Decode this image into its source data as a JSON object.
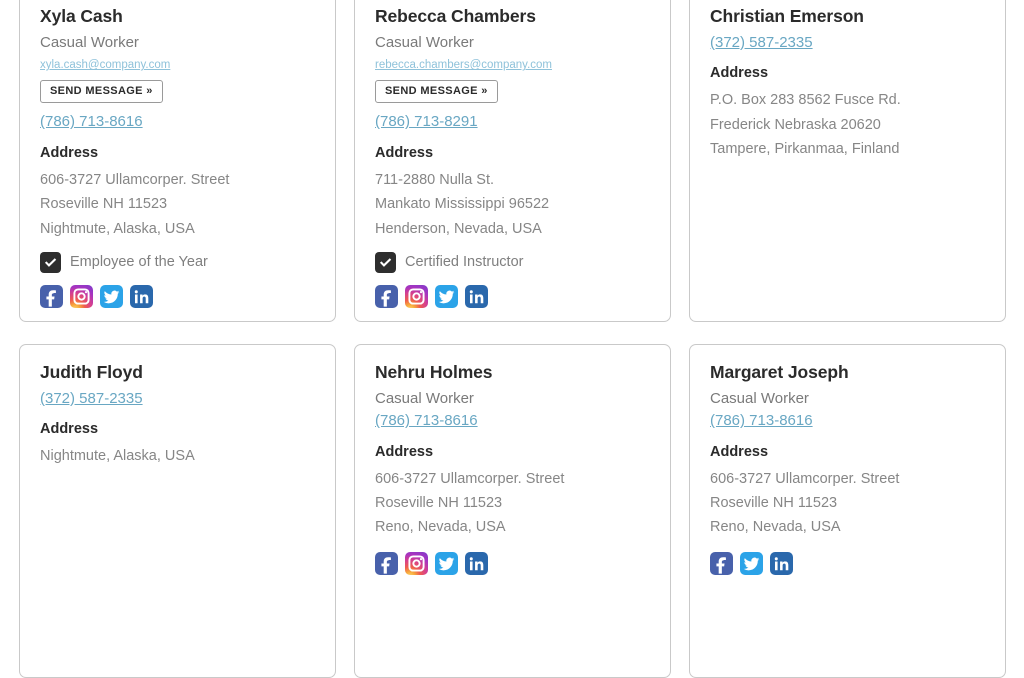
{
  "theme": {
    "page_background": "#ffffff",
    "card_background": "#ffffff",
    "card_border": "#c9c9c9",
    "name_color": "#2b2b2b",
    "role_color": "#7a7a7a",
    "email_link_color": "#8fc2da",
    "phone_link_color": "#69a7c3",
    "address_text_color": "#868686",
    "checkbox_color": "#2e2e2e",
    "facebook_color": "#4861ab",
    "twitter_color": "#2ba3e8",
    "linkedin_color": "#2a68ac",
    "instagram_gradient": "#d53f8f"
  },
  "labels": {
    "address_heading": "Address",
    "send_message": "SEND MESSAGE »"
  },
  "cards": [
    {
      "name": "Xyla Cash",
      "role": "Casual Worker",
      "email": "xyla.cash@company.com",
      "send_message_label": "SEND MESSAGE »",
      "phone": "(786) 713-8616",
      "address_heading": "Address",
      "address_lines": [
        "606-3727 Ullamcorper. Street",
        "Roseville NH 11523",
        "Nightmute, Alaska, USA"
      ],
      "badge": "Employee of the Year",
      "socials": [
        "facebook",
        "instagram",
        "twitter",
        "linkedin"
      ]
    },
    {
      "name": "Rebecca Chambers",
      "role": "Casual Worker",
      "email": "rebecca.chambers@company.com",
      "send_message_label": "SEND MESSAGE »",
      "phone": "(786) 713-8291",
      "address_heading": "Address",
      "address_lines": [
        "711-2880 Nulla St.",
        "Mankato Mississippi 96522",
        "Henderson, Nevada, USA"
      ],
      "badge": "Certified Instructor",
      "socials": [
        "facebook",
        "instagram",
        "twitter",
        "linkedin"
      ]
    },
    {
      "name": "Christian Emerson",
      "role": null,
      "email": null,
      "send_message_label": null,
      "phone": "(372) 587-2335",
      "address_heading": "Address",
      "address_lines": [
        "P.O. Box 283 8562 Fusce Rd.",
        "Frederick Nebraska 20620",
        "Tampere, Pirkanmaa, Finland"
      ],
      "badge": null,
      "socials": []
    },
    {
      "name": "Judith Floyd",
      "role": null,
      "email": null,
      "send_message_label": null,
      "phone": "(372) 587-2335",
      "address_heading": "Address",
      "address_lines": [
        "Nightmute, Alaska, USA"
      ],
      "badge": null,
      "socials": []
    },
    {
      "name": "Nehru Holmes",
      "role": "Casual Worker",
      "email": null,
      "send_message_label": null,
      "phone": "(786) 713-8616",
      "address_heading": "Address",
      "address_lines": [
        "606-3727 Ullamcorper. Street",
        "Roseville NH 11523",
        "Reno, Nevada, USA"
      ],
      "badge": null,
      "socials": [
        "facebook",
        "instagram",
        "twitter",
        "linkedin"
      ]
    },
    {
      "name": "Margaret Joseph",
      "role": "Casual Worker",
      "email": null,
      "send_message_label": null,
      "phone": "(786) 713-8616",
      "address_heading": "Address",
      "address_lines": [
        "606-3727 Ullamcorper. Street",
        "Roseville NH 11523",
        "Reno, Nevada, USA"
      ],
      "badge": null,
      "socials": [
        "facebook",
        "twitter",
        "linkedin"
      ]
    }
  ]
}
